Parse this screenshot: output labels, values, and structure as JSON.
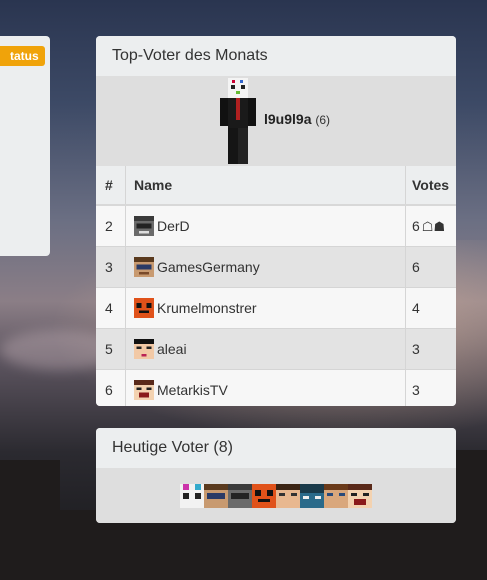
{
  "left_panel": {
    "badge": "tatus"
  },
  "top_voter": {
    "title": "Top-Voter des Monats",
    "winner": {
      "name": "l9u9l9a",
      "count": "(6)"
    },
    "table": {
      "headers": [
        "#",
        "Name",
        "Votes"
      ],
      "rows": [
        {
          "rank": "2",
          "name": "DerD",
          "votes": "6"
        },
        {
          "rank": "3",
          "name": "GamesGermany",
          "votes": "6"
        },
        {
          "rank": "4",
          "name": "Krumelmonstrer",
          "votes": "4"
        },
        {
          "rank": "5",
          "name": "aleai",
          "votes": "3"
        },
        {
          "rank": "6",
          "name": "MetarkisTV",
          "votes": "3"
        }
      ]
    }
  },
  "today": {
    "title": "Heutige Voter (8)"
  },
  "colors": {
    "badge": "#f0a30a",
    "panel": "#eceeef"
  }
}
